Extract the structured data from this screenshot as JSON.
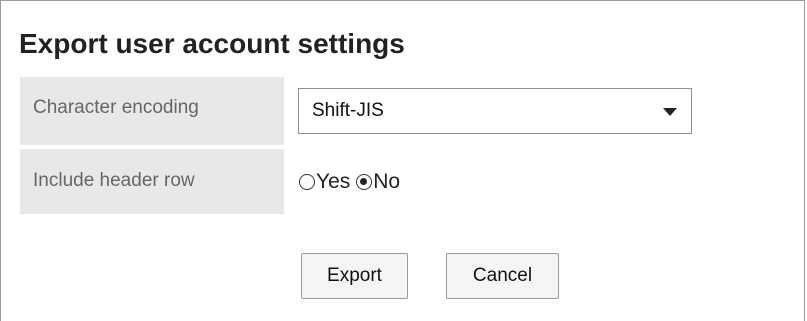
{
  "page": {
    "title": "Export user account settings"
  },
  "form": {
    "encoding": {
      "label": "Character encoding",
      "selected": "Shift-JIS"
    },
    "header_row": {
      "label": "Include header row",
      "options": [
        {
          "label": "Yes",
          "checked": false
        },
        {
          "label": "No",
          "checked": true
        }
      ]
    }
  },
  "actions": {
    "export_label": "Export",
    "cancel_label": "Cancel"
  }
}
